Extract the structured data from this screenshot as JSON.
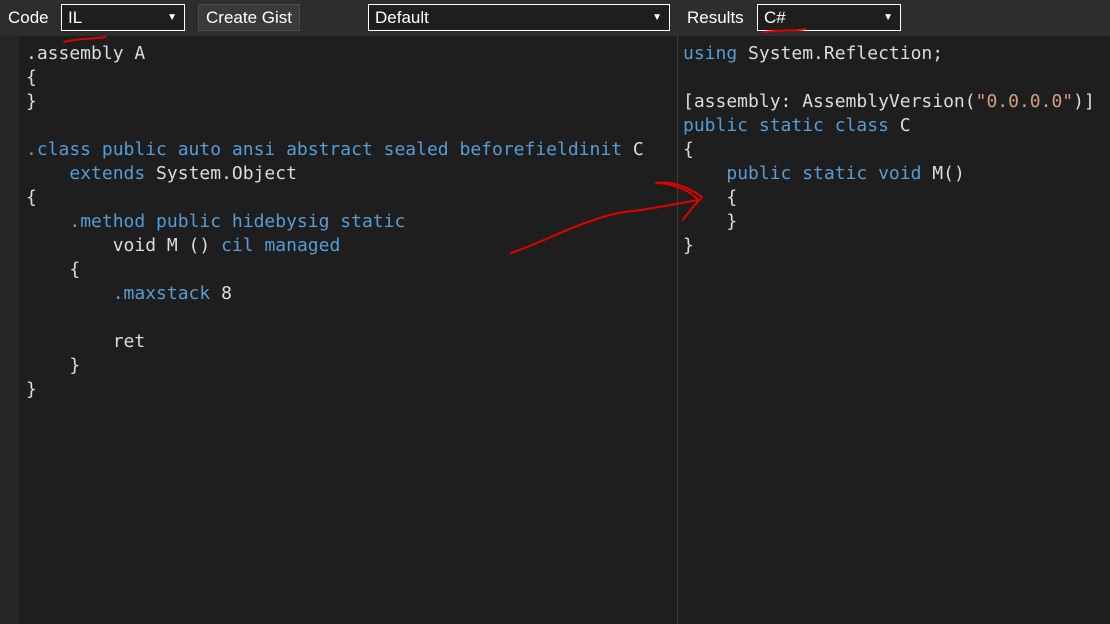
{
  "left_toolbar": {
    "code_label": "Code",
    "language_select": "IL",
    "create_gist_label": "Create Gist",
    "mode_select": "Default"
  },
  "right_toolbar": {
    "results_label": "Results",
    "output_select": "C#"
  },
  "colors": {
    "keyword": "#569cd6",
    "text": "#dcdcdc",
    "string": "#d69d85",
    "annotation": "#e00000"
  },
  "il_code": {
    "l1": ".assembly A",
    "l2": "{",
    "l3": "}",
    "l5_kw": ".class public auto ansi abstract sealed beforefieldinit",
    "l5_rest": " C",
    "l6_kw": "extends",
    "l6_rest": " System.Object",
    "l7": "{",
    "l8_kw": ".method public hidebysig static",
    "l9_plain": "void M ()",
    "l9_kw": "cil managed",
    "l10": "{",
    "l11_kw": ".maxstack",
    "l11_rest": " 8",
    "l13": "ret",
    "l14": "}",
    "l15": "}"
  },
  "cs_code": {
    "l1_kw": "using",
    "l1_rest": " System.Reflection;",
    "l3_pre": "[assembly: AssemblyVersion(",
    "l3_str": "\"0.0.0.0\"",
    "l3_post": ")]",
    "l4_kw": "public static class",
    "l4_rest": " C",
    "l5": "{",
    "l6_kw": "public static void",
    "l6_rest": " M()",
    "l7": "{",
    "l8": "}",
    "l9": "}"
  }
}
